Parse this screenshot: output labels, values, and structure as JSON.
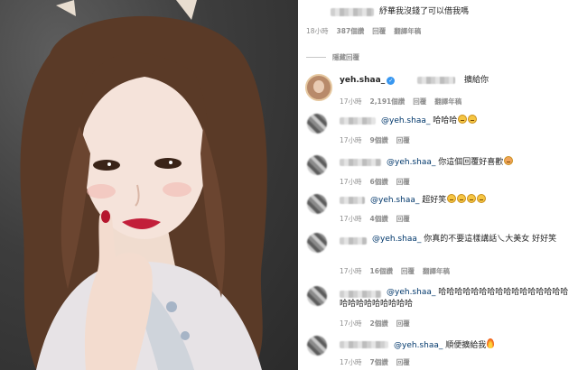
{
  "top_comment": {
    "text": "紓華我沒錢了可以借我嗎",
    "time": "18小時",
    "likes": "387個讚",
    "reply": "回覆",
    "translate": "翻譯年稿"
  },
  "hide_replies": "隱藏回覆",
  "replies": [
    {
      "username": "yeh.shaa_",
      "text": "擴給你",
      "time": "17小時",
      "likes": "2,191個讚",
      "reply": "回覆",
      "translate": "翻譯年稿"
    },
    {
      "mention": "@yeh.shaa_",
      "text": "哈哈哈",
      "time": "17小時",
      "likes": "9個讚",
      "reply": "回覆",
      "emoji": [
        "grin-sweat-emoji",
        "grin-sweat-emoji"
      ]
    },
    {
      "mention": "@yeh.shaa_",
      "text": "你這個回覆好喜歡",
      "time": "17小時",
      "likes": "6個讚",
      "reply": "回覆",
      "emoji": [
        "heart-eyes-emoji"
      ]
    },
    {
      "mention": "@yeh.shaa_",
      "text": "超好笑",
      "time": "17小時",
      "likes": "4個讚",
      "reply": "回覆",
      "emoji": [
        "grin-sweat-emoji",
        "grin-sweat-emoji",
        "grin-sweat-emoji",
        "grin-sweat-emoji"
      ]
    },
    {
      "mention": "@yeh.shaa_",
      "text": "你真的不要這樣講話乀大美女 好好笑",
      "time": "17小時",
      "likes": "16個讚",
      "reply": "回覆",
      "translate": "翻譯年稿"
    },
    {
      "mention": "@yeh.shaa_",
      "text": "哈哈哈哈哈哈哈哈哈哈哈哈哈哈哈哈哈哈哈哈哈哈哈哈哈",
      "time": "17小時",
      "likes": "2個讚",
      "reply": "回覆"
    },
    {
      "mention": "@yeh.shaa_",
      "text": "順便擴給我",
      "time": "17小時",
      "likes": "7個讚",
      "reply": "回覆",
      "emoji": [
        "fire-emoji"
      ]
    }
  ],
  "colors": {
    "mention": "#00376b",
    "meta": "#8e8e8e",
    "verified": "#3897f0",
    "text": "#262626"
  }
}
